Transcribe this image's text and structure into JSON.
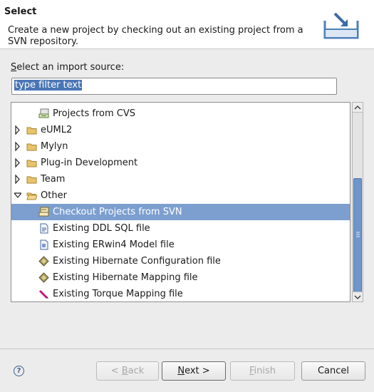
{
  "header": {
    "title": "Select",
    "description": "Create a new project by checking out an existing project from a SVN repository.",
    "icon": "import-wizard-icon"
  },
  "source": {
    "label_prefix": "",
    "label_mnemonic": "S",
    "label_rest": "elect an import source:",
    "filter_value": "type filter text"
  },
  "tree": {
    "items": [
      {
        "label": "Projects from CVS",
        "icon": "cvs-icon",
        "twisty": "none",
        "indent": 1
      },
      {
        "label": "eUML2",
        "icon": "folder-icon",
        "twisty": "collapsed",
        "indent": 0
      },
      {
        "label": "Mylyn",
        "icon": "folder-icon",
        "twisty": "collapsed",
        "indent": 0
      },
      {
        "label": "Plug-in Development",
        "icon": "folder-icon",
        "twisty": "collapsed",
        "indent": 0
      },
      {
        "label": "Team",
        "icon": "folder-icon",
        "twisty": "collapsed",
        "indent": 0
      },
      {
        "label": "Other",
        "icon": "folder-open-icon",
        "twisty": "expanded",
        "indent": 0
      },
      {
        "label": "Checkout Projects from SVN",
        "icon": "svn-icon",
        "twisty": "none",
        "indent": 1,
        "selected": true
      },
      {
        "label": "Existing DDL SQL file",
        "icon": "ddl-file-icon",
        "twisty": "none",
        "indent": 1
      },
      {
        "label": "Existing ERwin4 Model file",
        "icon": "erwin-file-icon",
        "twisty": "none",
        "indent": 1
      },
      {
        "label": "Existing Hibernate Configuration file",
        "icon": "hibernate-icon",
        "twisty": "none",
        "indent": 1
      },
      {
        "label": "Existing Hibernate Mapping file",
        "icon": "hibernate-icon",
        "twisty": "none",
        "indent": 1
      },
      {
        "label": "Existing Torque Mapping file",
        "icon": "torque-icon",
        "twisty": "none",
        "indent": 1
      }
    ]
  },
  "buttons": {
    "help": "?",
    "back_pre": "< ",
    "back_mn": "B",
    "back_post": "ack",
    "next_mn": "N",
    "next_post": "ext >",
    "finish_mn": "F",
    "finish_post": "inish",
    "cancel": "Cancel"
  },
  "colors": {
    "selection": "#7c9fd0",
    "accent": "#4a75b5"
  }
}
